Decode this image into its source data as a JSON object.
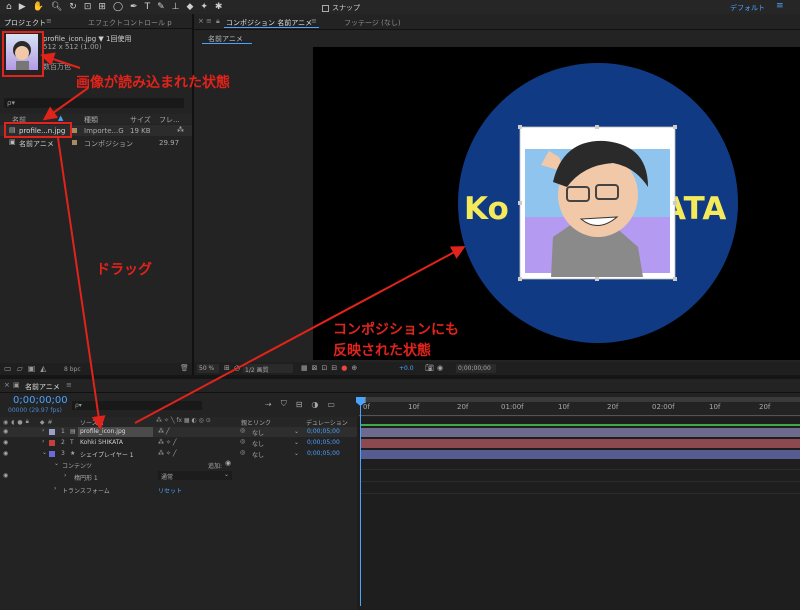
{
  "toolbar": {
    "snap_label": "スナップ",
    "workspace_label": "デフォルト",
    "menu_icon": "menu-icon"
  },
  "project_panel": {
    "tab_project": "プロジェクト",
    "tab_effects": "エフェクトコントロール p",
    "file_info_name": "profile_icon.jpg ▼ 1回使用",
    "file_info_dims": "512 x 512 (1.00)",
    "file_info_extra": "数百万色",
    "search_placeholder": "ρ▾",
    "columns": [
      "名前",
      "種類",
      "サイズ",
      "フレ..."
    ],
    "items": [
      {
        "name": "profile...n.jpg",
        "type": "Importe...G",
        "size": "19 KB",
        "fps": ""
      },
      {
        "name": "名前アニメ",
        "type": "コンポジション",
        "size": "",
        "fps": "29.97"
      }
    ],
    "bpc": "8 bpc"
  },
  "comp_panel": {
    "tab_comp": "コンポジション 名前アニメ",
    "tab_footage": "フッテージ (なし)",
    "subtab": "名前アニメ",
    "canvas_text": "KohKATA",
    "canvas_text_left": "Ko",
    "canvas_text_right": "ATA",
    "zoom": "50 %",
    "resolution": "1/2 画質",
    "exposure": "+0.0",
    "timecode": "0;00;00;00",
    "colors": {
      "circle": "#103a83",
      "title_text": "#f5ea5a"
    }
  },
  "timeline": {
    "tab": "名前アニメ",
    "timecode": "0;00;00;00",
    "fps_info": "00000 (29.97 fps)",
    "search_placeholder": "ρ▾",
    "col_source": "ソース名",
    "col_parent": "親とリンク",
    "col_duration": "デュレーション",
    "ruler_ticks": [
      "0f",
      "10f",
      "20f",
      "01:00f",
      "10f",
      "20f",
      "02:00f",
      "10f",
      "20f"
    ],
    "layers": [
      {
        "num": "1",
        "name": "profile_icon.jpg",
        "parent": "なし",
        "duration": "0;00;05;00",
        "color": "#9aa0c8",
        "track_color": "#6e6a8d"
      },
      {
        "num": "2",
        "name": "Kohki SHIKATA",
        "parent": "なし",
        "duration": "0;00;05;00",
        "color": "#c44040",
        "track_color": "#8c4a50"
      },
      {
        "num": "3",
        "name": "シェイプレイヤー 1",
        "parent": "なし",
        "duration": "0;00;05;00",
        "color": "#6a6ad8",
        "track_color": "#565b92"
      }
    ],
    "contents_label": "コンテンツ",
    "add_label": "追加:",
    "ellipse_label": "楕円形 1",
    "blend_mode": "通常",
    "transform_label": "トランスフォーム",
    "reset_label": "リセット"
  },
  "annotations": {
    "loaded": "画像が読み込まれた状態",
    "drag": "ドラッグ",
    "reflected_line1": "コンポジションにも",
    "reflected_line2": "反映された状態",
    "color": "#e0231b"
  }
}
